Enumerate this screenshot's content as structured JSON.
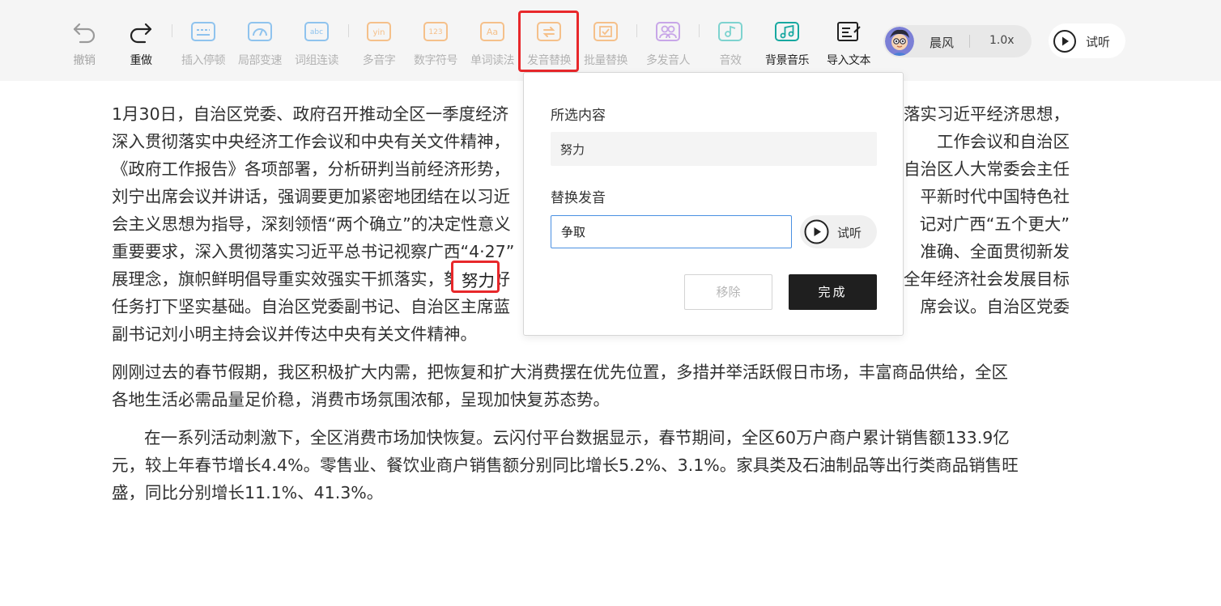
{
  "colors": {
    "toolbar_bg": "#f5f5f5",
    "highlight_red": "#e8282b",
    "done_button_bg": "#1f1f1f",
    "input_border_blue": "#4a90e2"
  },
  "toolbar": {
    "tools": [
      {
        "id": "undo",
        "label": "撤销",
        "icon": "undo-icon"
      },
      {
        "id": "redo",
        "label": "重做",
        "icon": "redo-icon"
      },
      {
        "id": "insert-pause",
        "label": "插入停顿",
        "icon": "keyboard-icon"
      },
      {
        "id": "local-speed",
        "label": "局部变速",
        "icon": "speedometer-icon"
      },
      {
        "id": "word-group",
        "label": "词组连读",
        "icon": "abc-icon",
        "icon_text": "abc"
      },
      {
        "id": "polyphone",
        "label": "多音字",
        "icon": "yin-icon",
        "icon_text": "yin"
      },
      {
        "id": "digit-symbol",
        "label": "数字符号",
        "icon": "123-icon",
        "icon_text": "123"
      },
      {
        "id": "word-reading",
        "label": "单词读法",
        "icon": "aa-icon",
        "icon_text": "Aa"
      },
      {
        "id": "pron-replace",
        "label": "发音替换",
        "icon": "pronunciation-swap-icon"
      },
      {
        "id": "batch-replace",
        "label": "批量替换",
        "icon": "batch-check-icon"
      },
      {
        "id": "multi-speaker",
        "label": "多发音人",
        "icon": "people-icon"
      },
      {
        "id": "sound-effect",
        "label": "音效",
        "icon": "sound-effect-icon"
      },
      {
        "id": "bg-music",
        "label": "背景音乐",
        "icon": "music-note-icon"
      },
      {
        "id": "import-text",
        "label": "导入文本",
        "icon": "import-text-icon"
      }
    ],
    "voice": {
      "name": "晨风",
      "speed": "1.0x",
      "avatar": "cartoon-boy-avatar"
    },
    "preview_label": "试听"
  },
  "article": {
    "lines": [
      "1月30日，自治区党委、政府召开推动全区一季度经济",
      "深入贯彻落实中央经济工作会议和中央有关文件精神，",
      "《政府工作报告》各项部署，分析研判当前经济形势，",
      "刘宁出席会议并讲话，强调要更加紧密地团结在以习近",
      "会主义思想为指导，深刻领悟“两个确立”的决定性意义",
      "重要要求，深入贯彻落实习近平总书记视察广西“4·27”",
      "展理念，旗帜鲜明倡导重实效强实干抓落实，努力做好",
      "任务打下坚实基础。自治区党委副书记、自治区主席蓝",
      "副书记刘小明主持会议并传达中央有关文件精神。"
    ],
    "right_fragments": [
      "落实习近平经济思想，",
      "工作会议和自治区",
      "自治区人大常委会主任",
      "平新时代中国特色社",
      "记对广西“五个更大”",
      "准确、全面贯彻新发",
      "全年经济社会发展目标",
      "席会议。自治区党委"
    ],
    "paragraph2": [
      "刚刚过去的春节假期，我区积极扩大内需，把恢复和扩大消费摆在优先位置，多措并举活跃假日市场，丰富商品供给，全区",
      "各地生活必需品量足价稳，消费市场氛围浓郁，呈现加快复苏态势。"
    ],
    "paragraph3": [
      "在一系列活动刺激下，全区消费市场加快恢复。云闪付平台数据显示，春节期间，全区60万户商户累计销售额133.9亿",
      "元，较上年春节增长4.4%。零售业、餐饮业商户销售额分别同比增长5.2%、3.1%。家具类及石油制品等出行类商品销售旺",
      "盛，同比分别增长11.1%、41.3%。"
    ],
    "highlighted_word": "努力"
  },
  "popover": {
    "selected_label": "所选内容",
    "selected_value": "努力",
    "replace_label": "替换发音",
    "replace_value": "争取",
    "preview_label": "试听",
    "remove_label": "移除",
    "done_label": "完成"
  }
}
